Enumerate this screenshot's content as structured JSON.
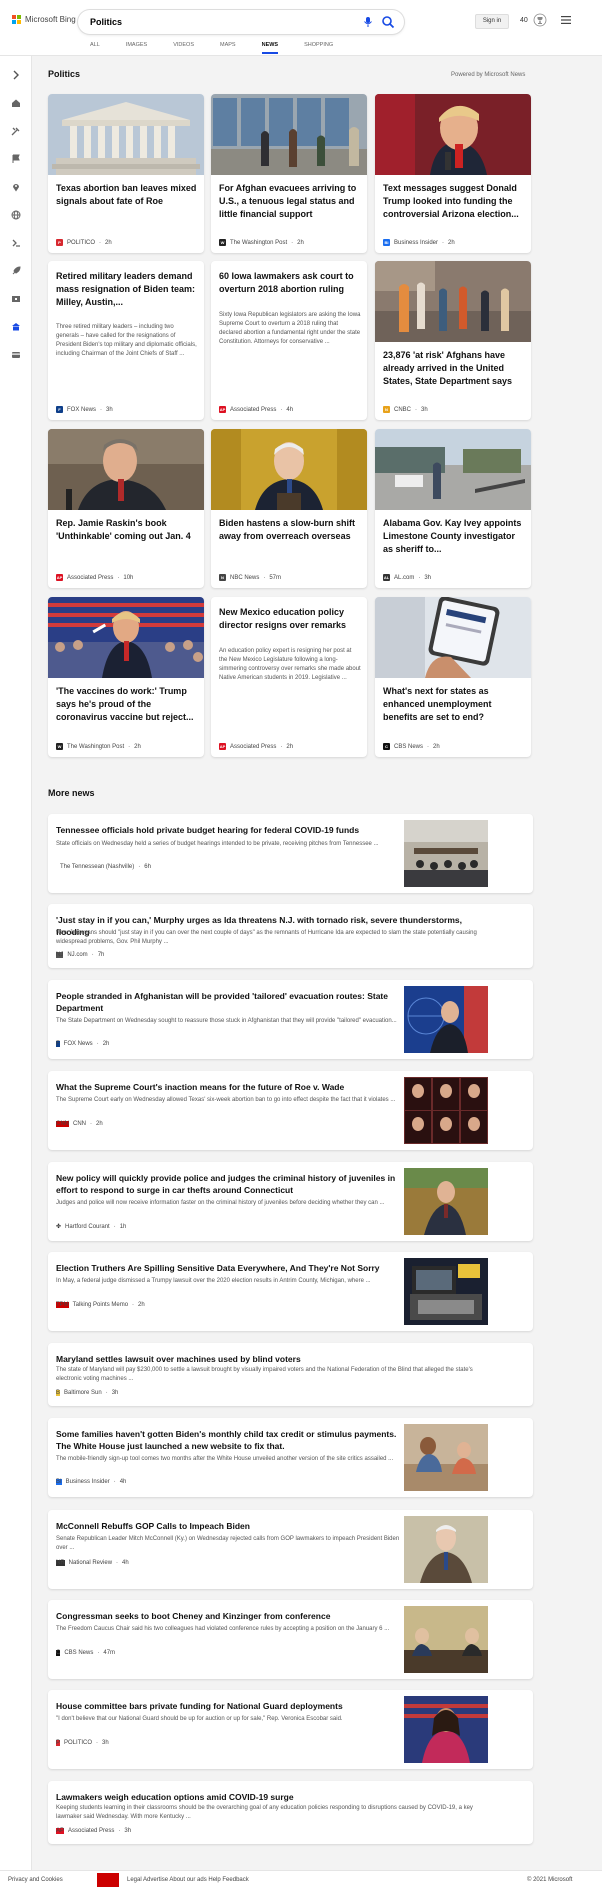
{
  "header": {
    "logo_text": "Microsoft Bing",
    "search_value": "Politics",
    "signin_label": "Sign in",
    "rewards_count": "40",
    "brand_colors": [
      "#f25022",
      "#7fba00",
      "#00a4ef",
      "#ffb900"
    ]
  },
  "tabs": [
    "ALL",
    "IMAGES",
    "VIDEOS",
    "MAPS",
    "NEWS",
    "SHOPPING"
  ],
  "rail_icons": [
    "arrow-right-icon",
    "home-icon",
    "tools-icon",
    "flag-icon",
    "location-icon",
    "globe-icon",
    "money-icon",
    "rocket-icon",
    "film-icon",
    "building-icon",
    "card-icon"
  ],
  "section": {
    "title": "Politics",
    "powered": "Powered by Microsoft News"
  },
  "cards": [
    {
      "title": "Texas abortion ban leaves mixed signals about fate of Roe",
      "snippet": "",
      "source": "POLITICO",
      "time": "2h"
    },
    {
      "title": "For Afghan evacuees arriving to U.S., a tenuous legal status and little financial support",
      "snippet": "",
      "source": "The Washington Post",
      "time": "2h"
    },
    {
      "title": "Text messages suggest Donald Trump looked into funding the controversial Arizona election...",
      "snippet": "",
      "source": "Business Insider",
      "time": "2h"
    },
    {
      "title": "Retired military leaders demand mass resignation of Biden team: Milley, Austin,...",
      "snippet": "Three retired military leaders – including two generals – have called for the resignations of President Biden's top military and diplomatic officials, including Chairman of the Joint Chiefs of Staff ...",
      "source": "FOX News",
      "time": "3h"
    },
    {
      "title": "60 Iowa lawmakers ask court to overturn 2018 abortion ruling",
      "snippet": "Sixty Iowa Republican legislators are asking the Iowa Supreme Court to overturn a 2018 ruling that declared abortion a fundamental right under the state Constitution. Attorneys for conservative ...",
      "source": "Associated Press",
      "time": "4h"
    },
    {
      "title": "23,876 'at risk' Afghans have already arrived in the United States, State Department says",
      "snippet": "",
      "source": "CNBC",
      "time": "3h"
    },
    {
      "title": "Rep. Jamie Raskin's book 'Unthinkable' coming out Jan. 4",
      "snippet": "",
      "source": "Associated Press",
      "time": "10h"
    },
    {
      "title": "Biden hastens a slow-burn shift away from overreach overseas",
      "snippet": "",
      "source": "NBC News",
      "time": "57m"
    },
    {
      "title": "Alabama Gov. Kay Ivey appoints Limestone County investigator as sheriff to...",
      "snippet": "",
      "source": "AL.com",
      "time": "3h"
    },
    {
      "title": "'The vaccines do work:' Trump says he's proud of the coronavirus vaccine but reject...",
      "snippet": "",
      "source": "The Washington Post",
      "time": "2h"
    },
    {
      "title": "New Mexico education policy director resigns over remarks",
      "snippet": "An education policy expert is resigning her post at the New Mexico Legislature following a long-simmering controversy over remarks she made about Native American students in 2019. Legislative ...",
      "source": "Associated Press",
      "time": "2h"
    },
    {
      "title": "What's next for states as enhanced unemployment benefits are set to end?",
      "snippet": "",
      "source": "CBS News",
      "time": "2h"
    }
  ],
  "more_news_title": "More news",
  "more_news": [
    {
      "title": "Tennessee officials hold private budget hearing for federal COVID-19 funds",
      "snippet": "State officials on Wednesday held a series of budget hearings intended to be private, receiving pitches from Tennessee ...",
      "source": "The Tennessean (Nashville)",
      "time": "6h"
    },
    {
      "title": "'Just stay in if you can,' Murphy urges as Ida threatens N.J. with tornado risk, severe thunderstorms, flooding",
      "snippet": "New Jerseyans should \"just stay in if you can over the next couple of days\" as the remnants of Hurricane Ida are expected to slam the state potentially causing widespread problems, Gov. Phil Murphy ...",
      "source": "NJ.com",
      "time": "7h"
    },
    {
      "title": "People stranded in Afghanistan will be provided 'tailored' evacuation routes: State Department",
      "snippet": "The State Department on Wednesday sought to reassure those stuck in Afghanistan that they will provide \"tailored\" evacuation...",
      "source": "FOX News",
      "time": "2h"
    },
    {
      "title": "What the Supreme Court's inaction means for the future of Roe v. Wade",
      "snippet": "The Supreme Court early on Wednesday allowed Texas' six-week abortion ban to go into effect despite the fact that it violates ...",
      "source": "CNN",
      "time": "2h"
    },
    {
      "title": "New policy will quickly provide police and judges the criminal history of juveniles in effort to respond to surge in car thefts around Connecticut",
      "snippet": "Judges and police will now receive information faster on the criminal history of juveniles before deciding whether they can ...",
      "source": "Hartford Courant",
      "time": "1h"
    },
    {
      "title": "Election Truthers Are Spilling Sensitive Data Everywhere, And They're Not Sorry",
      "snippet": "In May, a federal judge dismissed a Trumpy lawsuit over the 2020 election results in Antrim County, Michigan, where ...",
      "source": "Talking Points Memo",
      "time": "2h"
    },
    {
      "title": "Maryland settles lawsuit over machines used by blind voters",
      "snippet": "The state of Maryland will pay $230,000 to settle a lawsuit brought by visually impaired voters and the National Federation of the Blind that alleged the state's electronic voting machines ...",
      "source": "Baltimore Sun",
      "time": "3h"
    },
    {
      "title": "Some families haven't gotten Biden's monthly child tax credit or stimulus payments. The White House just launched a new website to fix that.",
      "snippet": "The mobile-friendly sign-up tool comes two months after the White House unveiled another version of the site critics assailed ...",
      "source": "Business Insider",
      "time": "4h"
    },
    {
      "title": "McConnell Rebuffs GOP Calls to Impeach Biden",
      "snippet": "Senate Republican Leader Mitch McConnell (Ky.) on Wednesday rejected calls from GOP lawmakers to impeach President Biden over ...",
      "source": "National Review",
      "time": "4h"
    },
    {
      "title": "Congressman seeks to boot Cheney and Kinzinger from conference",
      "snippet": "The Freedom Caucus Chair said his two colleagues had violated conference rules by accepting a position on the January 6 ...",
      "source": "CBS News",
      "time": "47m"
    },
    {
      "title": "House committee bars private funding for National Guard deployments",
      "snippet": "\"I don't believe that our National Guard should be up for auction or up for sale,\" Rep. Veronica Escobar said.",
      "source": "POLITICO",
      "time": "3h"
    },
    {
      "title": "Lawmakers weigh education options amid COVID-19 surge",
      "snippet": "Keeping students learning in their classrooms should be the overarching goal of any education policies responding to disruptions caused by COVID-19, a key lawmaker said Wednesday. With more Kentucky ...",
      "source": "Associated Press",
      "time": "3h"
    }
  ],
  "footer": {
    "left": "Privacy and Cookies",
    "middle": "Legal  Advertise  About our ads  Help  Feedback",
    "right": "© 2021 Microsoft"
  }
}
